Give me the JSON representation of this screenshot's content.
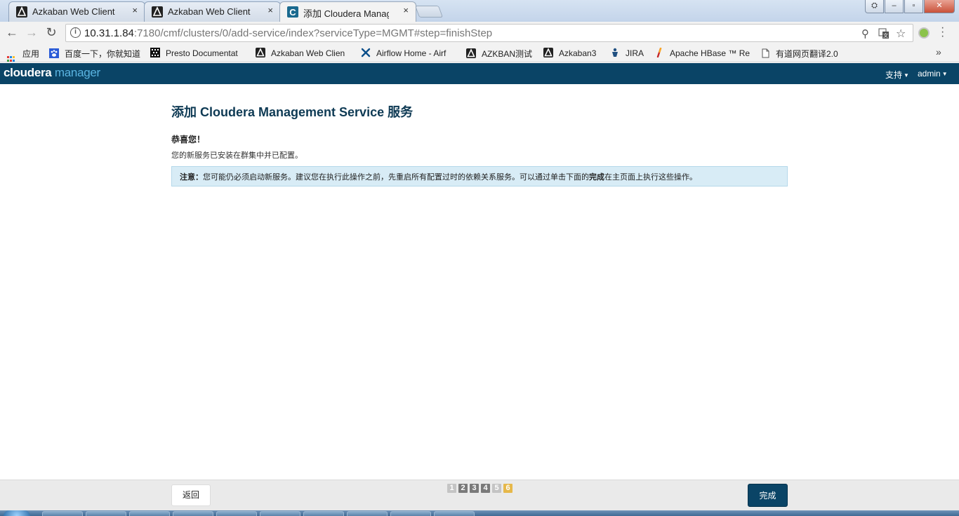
{
  "browser": {
    "tabs": [
      {
        "label": "Azkaban Web Client",
        "close": "×",
        "active": false
      },
      {
        "label": "Azkaban Web Client",
        "close": "×",
        "active": false
      },
      {
        "label": "添加 Cloudera Manage",
        "close": "×",
        "active": true
      }
    ],
    "window_buttons": {
      "user": "⛭",
      "minimize": "‒",
      "maximize": "▫",
      "close": "✕"
    },
    "url_host": "10.31.1.84",
    "url_rest": ":7180/cmf/clusters/0/add-service/index?serviceType=MGMT#step=finishStep",
    "bookmarks": [
      {
        "label": "应用",
        "icon": "apps-grid-icon"
      },
      {
        "label": "百度一下，你就知道",
        "icon": "baidu-paw-icon"
      },
      {
        "label": "Presto Documentat",
        "icon": "presto-icon"
      },
      {
        "label": "Azkaban Web Clien",
        "icon": "azkaban-icon"
      },
      {
        "label": "Airflow Home - Airf",
        "icon": "airflow-icon"
      },
      {
        "label": "AZKBAN测试",
        "icon": "azkaban-icon"
      },
      {
        "label": "Azkaban3",
        "icon": "azkaban-icon"
      },
      {
        "label": "JIRA",
        "icon": "jira-icon"
      },
      {
        "label": "Apache HBase ™ Re",
        "icon": "hbase-icon"
      },
      {
        "label": "有道网页翻译2.0",
        "icon": "page-icon"
      }
    ],
    "bookmarks_more": "»"
  },
  "app": {
    "logo_main": "cloudera",
    "logo_sub": "manager",
    "nav_support": "支持",
    "nav_user": "admin",
    "nav_caret": "▼"
  },
  "main": {
    "title": "添加 Cloudera Management Service 服务",
    "congrats": "恭喜您！",
    "description": "您的新服务已安装在群集中并已配置。",
    "notice_label": "注意：",
    "notice_text_1": "您可能仍必须启动新服务。建议您在执行此操作之前，先重启所有配置过时的依赖关系服务。可以通过单击下面的",
    "notice_bold": "完成",
    "notice_text_2": "在主页面上执行这些操作。"
  },
  "footer": {
    "back_label": "返回",
    "steps": [
      {
        "label": "1",
        "state": "inactive"
      },
      {
        "label": "2",
        "state": "done"
      },
      {
        "label": "3",
        "state": "done"
      },
      {
        "label": "4",
        "state": "done"
      },
      {
        "label": "5",
        "state": "inactive"
      },
      {
        "label": "6",
        "state": "current"
      }
    ],
    "finish_label": "完成"
  },
  "colors": {
    "header_bg": "#0a4466",
    "logo_accent": "#5ab4e1",
    "notice_bg": "#d8ecf6",
    "step_done": "#7a7a7a",
    "step_inactive": "#c4c4c4",
    "step_current": "#e6b84a"
  }
}
